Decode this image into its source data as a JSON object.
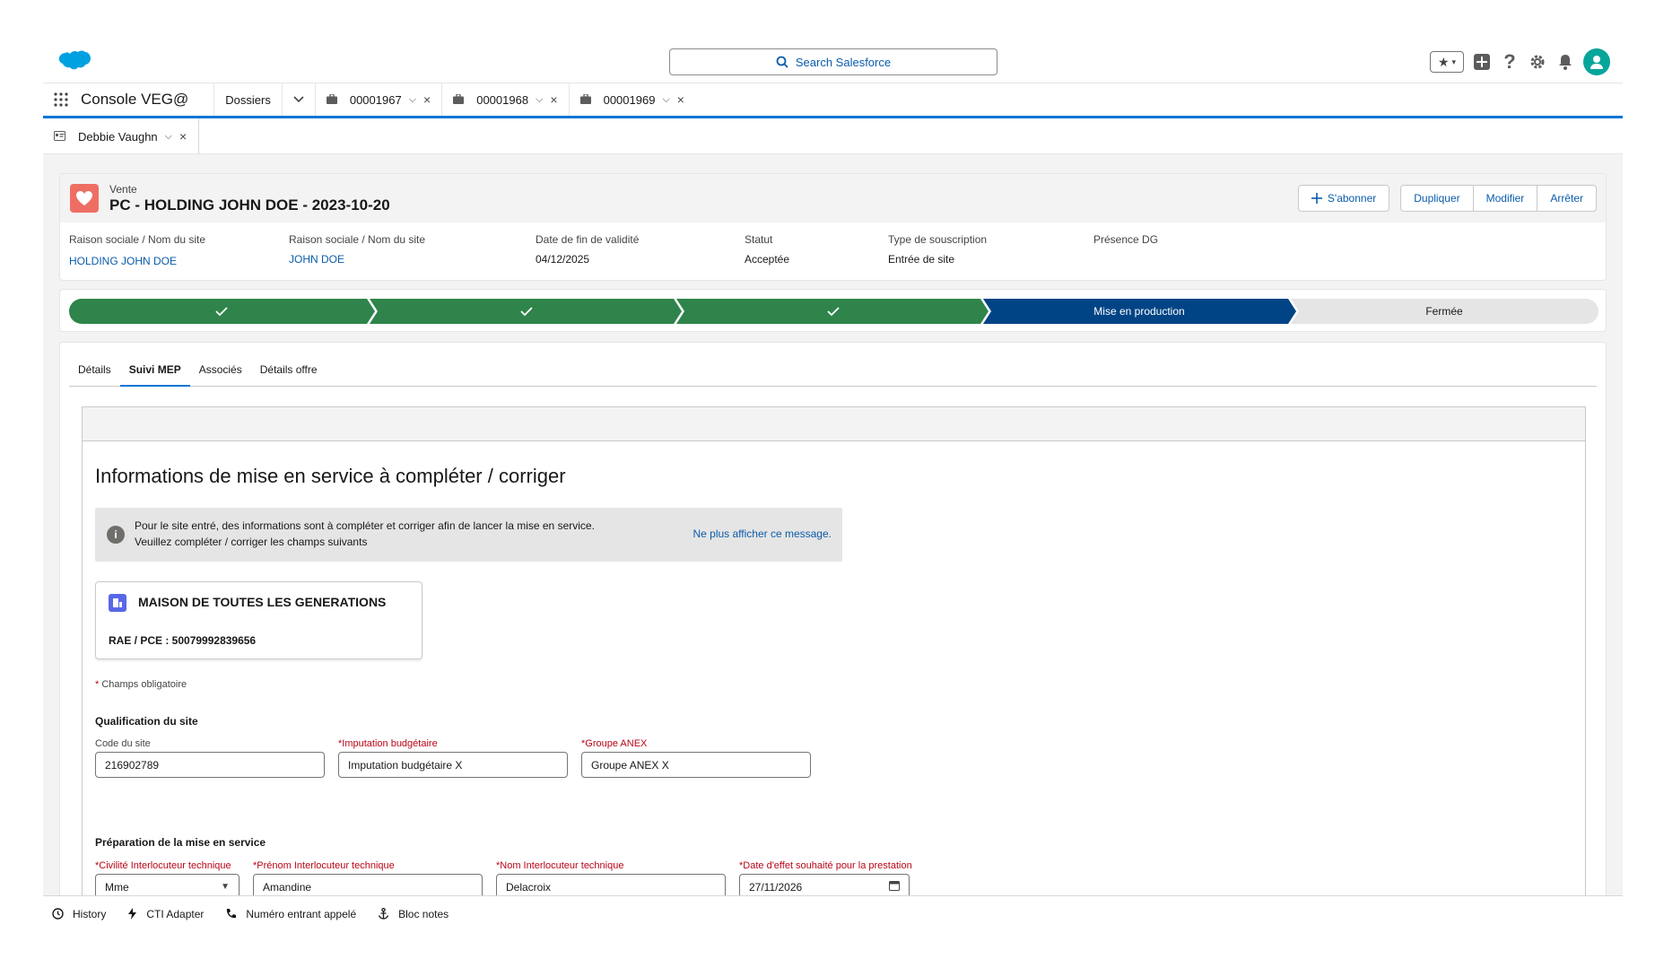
{
  "global_header": {
    "search_placeholder": "Search Salesforce",
    "icons": [
      "favorites-icon",
      "add-icon",
      "help-icon",
      "setup-gear-icon",
      "notifications-bell-icon",
      "user-avatar"
    ]
  },
  "nav": {
    "app_name": "Console VEG@",
    "object_dropdown": "Dossiers",
    "record_tabs": [
      {
        "label": "00001967"
      },
      {
        "label": "00001968"
      },
      {
        "label": "00001969"
      }
    ]
  },
  "subtab": {
    "label": "Debbie Vaughn"
  },
  "record": {
    "object_type": "Vente",
    "title": "PC - HOLDING JOHN DOE - 2023-10-20",
    "actions": {
      "subscribe": "S'abonner",
      "duplicate": "Dupliquer",
      "edit": "Modifier",
      "stop": "Arrêter"
    },
    "fields": [
      {
        "label": "Raison sociale / Nom du site",
        "value": "HOLDING JOHN DOE"
      },
      {
        "label": "Raison sociale / Nom du site",
        "value": "JOHN DOE"
      },
      {
        "label": "Date de fin de validité",
        "value": "04/12/2025"
      },
      {
        "label": "Statut",
        "value": "Acceptée"
      },
      {
        "label": "Type de souscription",
        "value": "Entrée de site"
      },
      {
        "label": "Présence DG",
        "value": ""
      }
    ]
  },
  "path": {
    "stages": [
      {
        "label": "",
        "state": "complete"
      },
      {
        "label": "",
        "state": "complete"
      },
      {
        "label": "",
        "state": "complete"
      },
      {
        "label": "Mise en production",
        "state": "current"
      },
      {
        "label": "Fermée",
        "state": "incomplete"
      }
    ],
    "colors": {
      "complete": "#2e844a",
      "current": "#014486",
      "incomplete": "#e5e5e5"
    }
  },
  "tabs": [
    {
      "label": "Détails",
      "active": false
    },
    {
      "label": "Suivi MEP",
      "active": true
    },
    {
      "label": "Associés",
      "active": false
    },
    {
      "label": "Détails offre",
      "active": false
    }
  ],
  "mep": {
    "title": "Informations de mise en service à compléter / corriger",
    "info_line1": "Pour le site entré, des informations sont à compléter et corriger afin de lancer la mise en service.",
    "info_line2": "Veuillez compléter / corriger les champs suivants",
    "info_dismiss": "Ne plus afficher ce message.",
    "site_name": "MAISON DE TOUTES LES GENERATIONS",
    "site_rae": "RAE / PCE : 50079992839656",
    "required_note": "Champs obligatoire",
    "qualification": {
      "heading": "Qualification du site",
      "code_label": "Code du site",
      "code_value": "216902789",
      "imputation_label": "Imputation budgétaire",
      "imputation_value": "Imputation budgétaire X",
      "groupe_label": "Groupe ANEX",
      "groupe_value": "Groupe ANEX X"
    },
    "preparation": {
      "heading": "Préparation de la mise en service",
      "civilite_label": "Civilité Interlocuteur technique",
      "civilite_value": "Mme",
      "prenom_label": "Prénom Interlocuteur technique",
      "prenom_value": "Amandine",
      "nom_label": "Nom Interlocuteur technique",
      "nom_value": "Delacroix",
      "date_label": "Date d'effet souhaité pour la prestation",
      "date_value": "27/11/2026"
    }
  },
  "utility_bar": [
    {
      "label": "History",
      "icon": "clock-icon"
    },
    {
      "label": "CTI Adapter",
      "icon": "lightning-icon"
    },
    {
      "label": "Numéro entrant appelé",
      "icon": "phone-icon"
    },
    {
      "label": "Bloc notes",
      "icon": "anchor-icon"
    }
  ]
}
